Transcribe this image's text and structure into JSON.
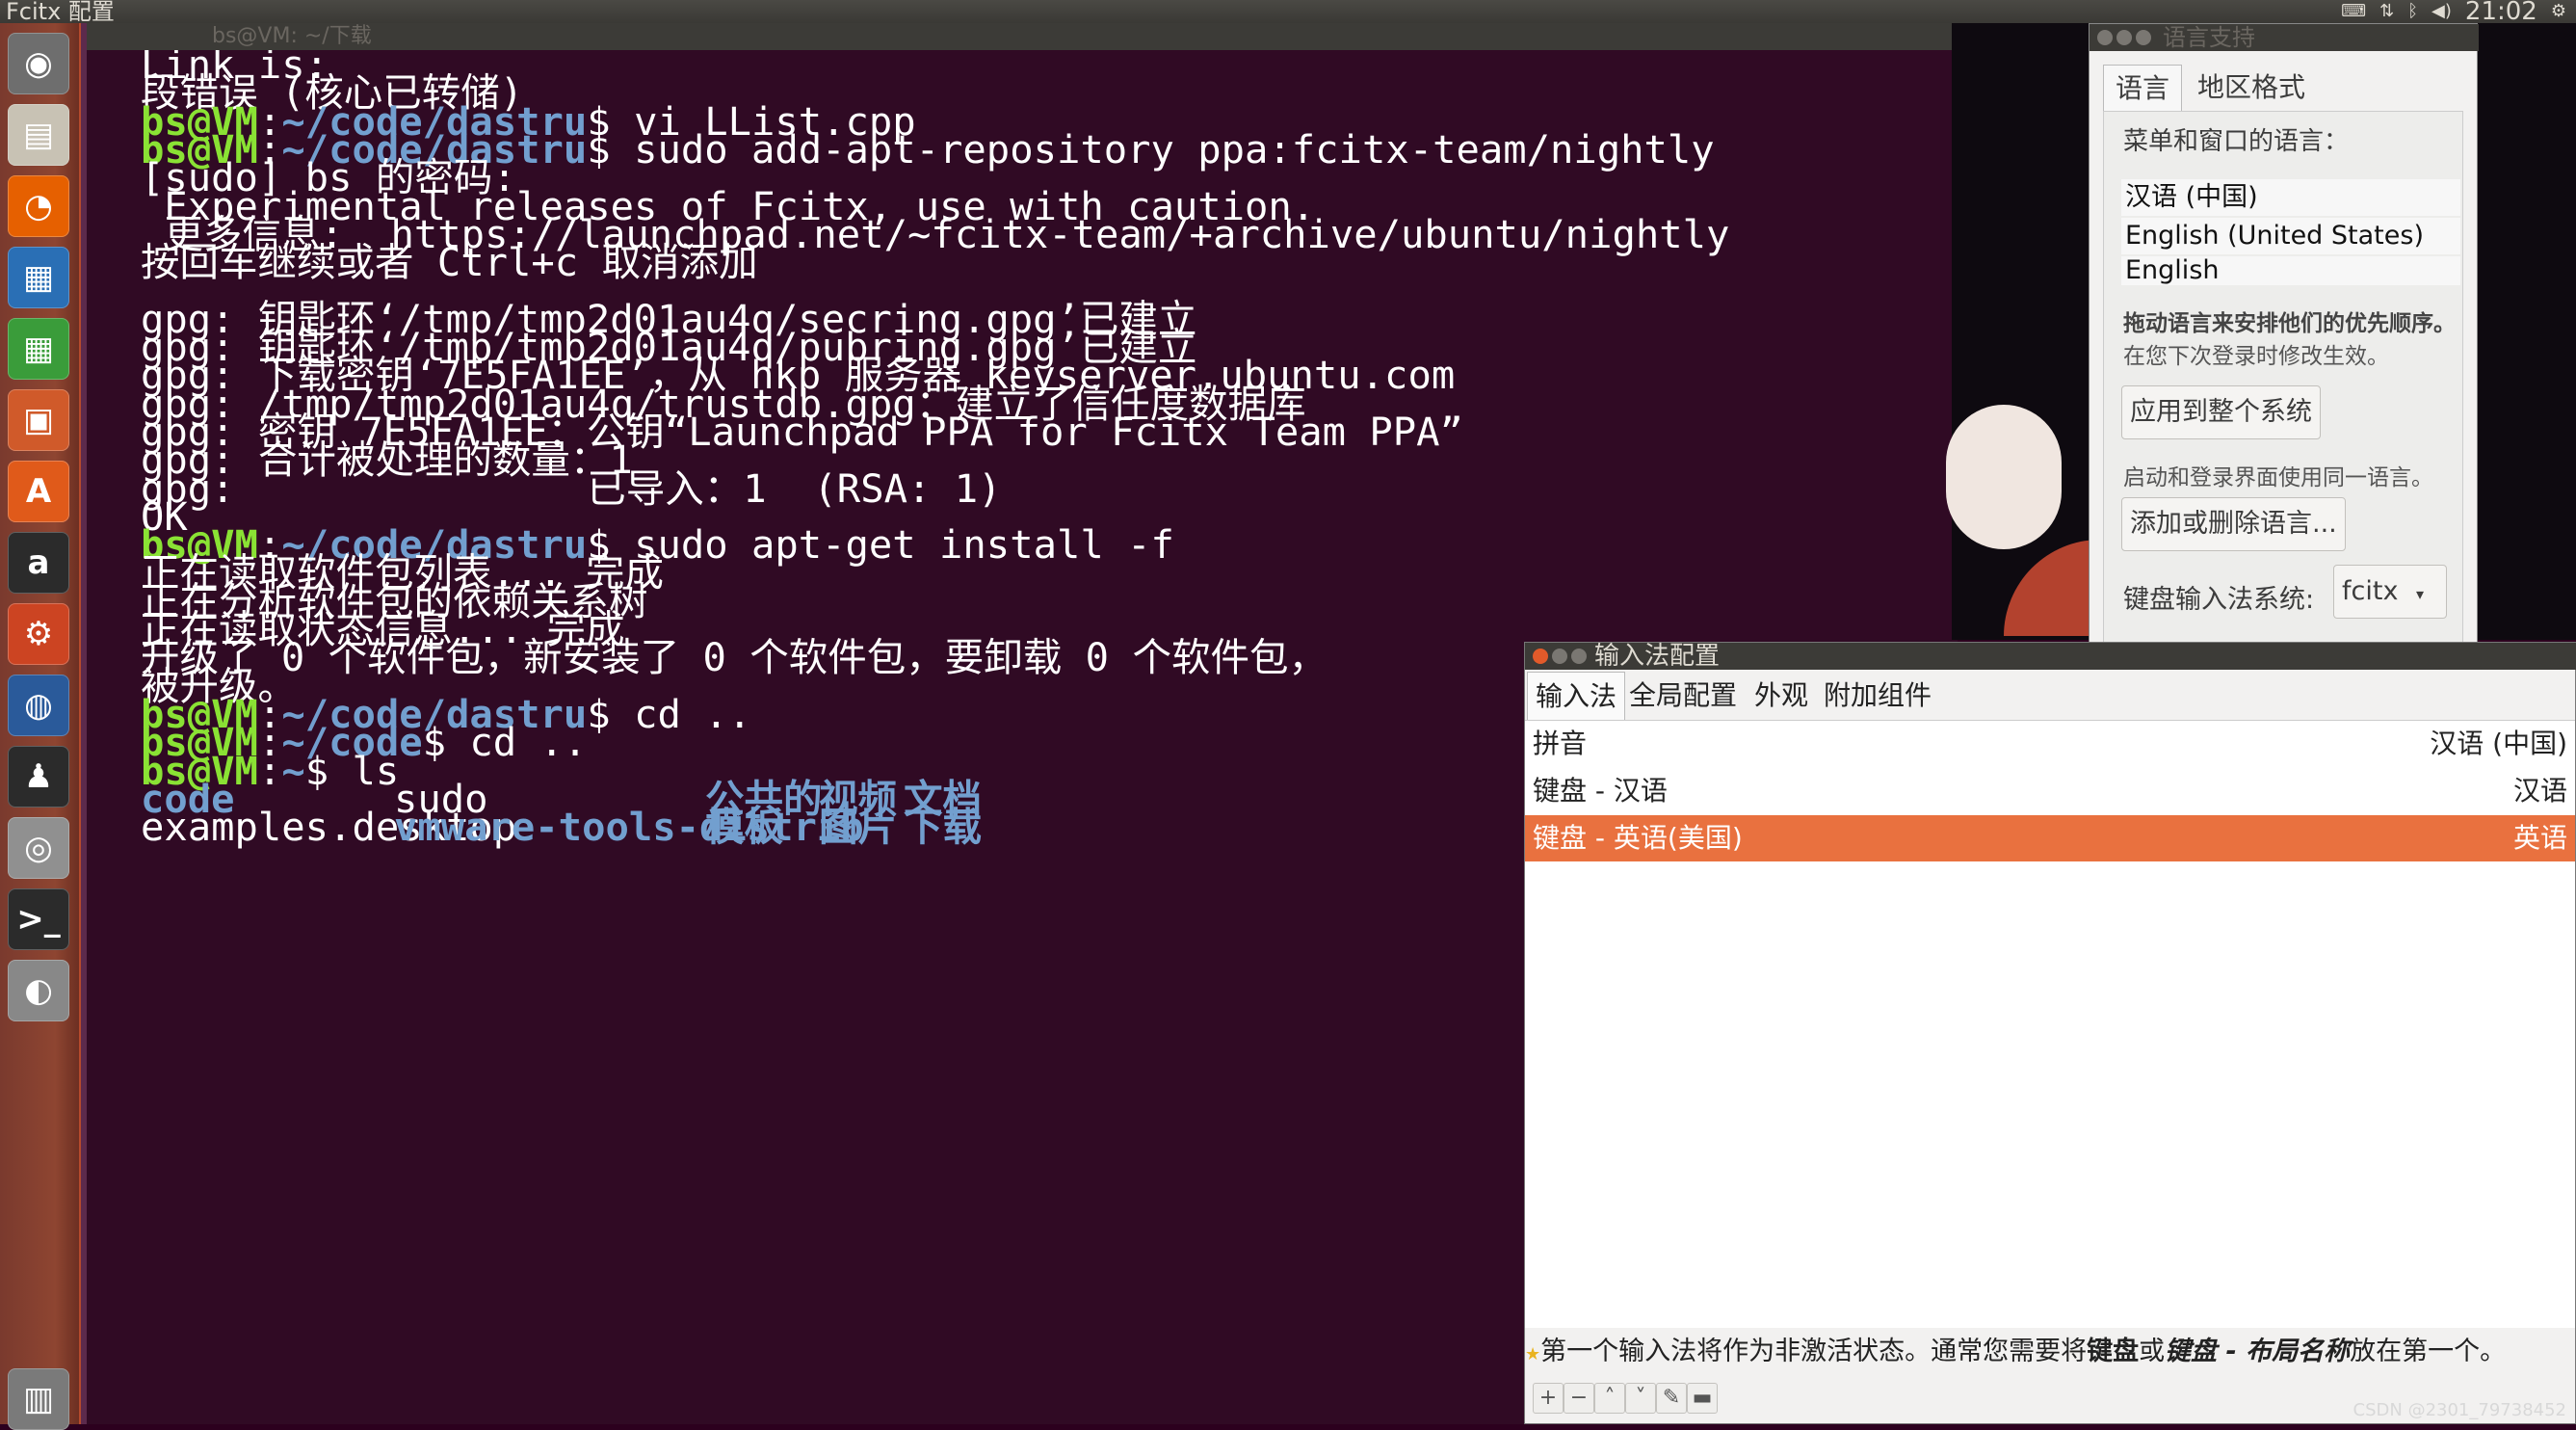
{
  "top_panel": {
    "app_title": "Fcitx 配置",
    "clock": "21:02",
    "tray_icons": [
      "input-method-icon",
      "network-icon",
      "bluetooth-icon",
      "volume-icon",
      "gear-icon"
    ]
  },
  "launcher": {
    "items": [
      {
        "name": "ubuntu-dash-icon",
        "glyph": "◉"
      },
      {
        "name": "files-icon",
        "glyph": "▤"
      },
      {
        "name": "firefox-icon",
        "glyph": "◔"
      },
      {
        "name": "writer-icon",
        "glyph": "▦"
      },
      {
        "name": "calc-icon",
        "glyph": "▦"
      },
      {
        "name": "impress-icon",
        "glyph": "▣"
      },
      {
        "name": "software-center-icon",
        "glyph": "A"
      },
      {
        "name": "amazon-icon",
        "glyph": "a"
      },
      {
        "name": "system-settings-icon",
        "glyph": "⚙"
      },
      {
        "name": "disk-icon",
        "glyph": "◍"
      },
      {
        "name": "qq-icon",
        "glyph": "♟"
      },
      {
        "name": "camera-icon",
        "glyph": "◎"
      },
      {
        "name": "terminal-icon",
        "glyph": ">_"
      },
      {
        "name": "dvd-icon",
        "glyph": "◐"
      },
      {
        "name": "trash-icon",
        "glyph": "▥"
      }
    ]
  },
  "terminal": {
    "title": "bs@VM: ~/下载",
    "prompt_user": "bs@VM",
    "lines": [
      {
        "type": "out",
        "text": "Link is:"
      },
      {
        "type": "out",
        "text": "段错误 (核心已转储)"
      },
      {
        "type": "cmd",
        "path": "~/code/dastru",
        "cmd": "vi LList.cpp"
      },
      {
        "type": "cmd",
        "path": "~/code/dastru",
        "cmd": "sudo add-apt-repository ppa:fcitx-team/nightly"
      },
      {
        "type": "out",
        "text": "[sudo] bs 的密码:"
      },
      {
        "type": "out",
        "text": " Experimental releases of Fcitx, use with caution."
      },
      {
        "type": "out",
        "text": " 更多信息:  https://launchpad.net/~fcitx-team/+archive/ubuntu/nightly"
      },
      {
        "type": "out",
        "text": "按回车继续或者 Ctrl+c 取消添加"
      },
      {
        "type": "out",
        "text": ""
      },
      {
        "type": "out",
        "text": "gpg: 钥匙环‘/tmp/tmp2d01au4q/secring.gpg’已建立"
      },
      {
        "type": "out",
        "text": "gpg: 钥匙环‘/tmp/tmp2d01au4q/pubring.gpg’已建立"
      },
      {
        "type": "out",
        "text": "gpg: 下载密钥‘7E5FA1EE’，从 hkp 服务器 keyserver.ubuntu.com"
      },
      {
        "type": "out",
        "text": "gpg: /tmp/tmp2d01au4q/trustdb.gpg：建立了信任度数据库"
      },
      {
        "type": "out",
        "text": "gpg: 密钥 7E5FA1EE：公钥“Launchpad PPA for Fcitx Team PPA”"
      },
      {
        "type": "out",
        "text": "gpg: 合计被处理的数量：1"
      },
      {
        "type": "out",
        "text": "gpg:               已导入：1  (RSA: 1)"
      },
      {
        "type": "out",
        "text": "OK"
      },
      {
        "type": "cmd",
        "path": "~/code/dastru",
        "cmd": "sudo apt-get install -f"
      },
      {
        "type": "out",
        "text": "正在读取软件包列表... 完成"
      },
      {
        "type": "out",
        "text": "正在分析软件包的依赖关系树"
      },
      {
        "type": "out",
        "text": "正在读取状态信息... 完成"
      },
      {
        "type": "out",
        "text": "升级了 0 个软件包，新安装了 0 个软件包，要卸载 0 个软件包，"
      },
      {
        "type": "out",
        "text": "被升级。"
      },
      {
        "type": "cmd",
        "path": "~/code/dastru",
        "cmd": "cd .."
      },
      {
        "type": "cmd",
        "path": "~/code",
        "cmd": "cd .."
      },
      {
        "type": "cmd",
        "path": "~",
        "cmd": "ls"
      }
    ],
    "ls_row1": {
      "c1": "code",
      "c2": "sudo",
      "c3": "公共的",
      "c4": "视频",
      "c5": "文档"
    },
    "ls_row2": {
      "c1": "examples.desktop",
      "c2": "vmware-tools-distrib",
      "c3": "模板",
      "c4": "图片",
      "c5": "下载"
    }
  },
  "language_support": {
    "title": "语言支持",
    "tabs": [
      "语言",
      "地区格式"
    ],
    "menu_lang_label": "菜单和窗口的语言：",
    "languages": [
      "汉语 (中国)",
      "English (United States)",
      "English"
    ],
    "drag_hint_bold": "拖动语言来安排他们的优先顺序。",
    "drag_hint": "在您下次登录时修改生效。",
    "apply_button": "应用到整个系统",
    "login_hint": "启动和登录界面使用同一语言。",
    "add_remove_button": "添加或删除语言...",
    "keyboard_im_label": "键盘输入法系统:",
    "keyboard_im_value": "fcitx"
  },
  "fcitx_config": {
    "title": "输入法配置",
    "tabs": [
      "输入法",
      "全局配置",
      "外观",
      "附加组件"
    ],
    "rows": [
      {
        "name": "拼音",
        "lang": "汉语 (中国)",
        "selected": false
      },
      {
        "name": "键盘 - 汉语",
        "lang": "汉语",
        "selected": false
      },
      {
        "name": "键盘 - 英语(美国)",
        "lang": "英语",
        "selected": true
      }
    ],
    "hint_parts": {
      "p1": "第一个输入法将作为非激活状态。通常您需要将",
      "b1": "键盘",
      "p2": "或",
      "b2": "键盘 - 布局名称",
      "p3": "放在第一个。"
    },
    "toolbar": [
      "+",
      "−",
      "˄",
      "˅",
      "✎",
      "▬"
    ]
  },
  "watermark": "CSDN @2301_79738452",
  "colors": {
    "terminal_bg": "#300a24",
    "prompt_user": "#8ae234",
    "prompt_path": "#729fcf",
    "selection": "#e9713f",
    "launcher": "#8e4531"
  }
}
